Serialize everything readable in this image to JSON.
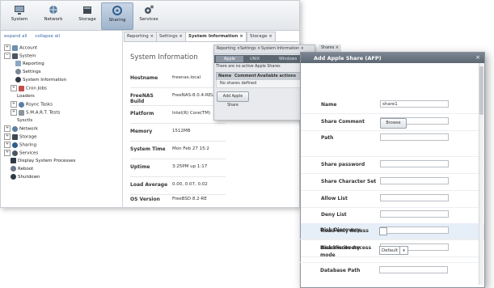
{
  "toolbar": {
    "items": [
      {
        "label": "System"
      },
      {
        "label": "Network"
      },
      {
        "label": "Storage"
      },
      {
        "label": "Sharing"
      },
      {
        "label": "Services"
      }
    ]
  },
  "sidebar": {
    "expand_all": "expand all",
    "collapse_all": "collapse all",
    "items": [
      {
        "label": "Account"
      },
      {
        "label": "System"
      },
      {
        "label": "Reporting"
      },
      {
        "label": "Settings"
      },
      {
        "label": "System Information"
      },
      {
        "label": "Cron Jobs"
      },
      {
        "label": "Loaders"
      },
      {
        "label": "Rsync Tasks"
      },
      {
        "label": "S.M.A.R.T. Tests"
      },
      {
        "label": "Sysctls"
      },
      {
        "label": "Network"
      },
      {
        "label": "Storage"
      },
      {
        "label": "Sharing"
      },
      {
        "label": "Services"
      },
      {
        "label": "Display System Processes"
      },
      {
        "label": "Reboot"
      },
      {
        "label": "Shutdown"
      }
    ]
  },
  "tabs": [
    {
      "label": "Reporting ×"
    },
    {
      "label": "Settings ×"
    },
    {
      "label": "System Information ×"
    },
    {
      "label": "Storage ×"
    }
  ],
  "sysinfo": {
    "title": "System Information",
    "rows": [
      {
        "k": "Hostname",
        "v": "freenas.local"
      },
      {
        "k": "FreeNAS Build",
        "v": "FreeNAS-8.0.4-RELEASE"
      },
      {
        "k": "Platform",
        "v": "Intel(R) Core(TM)"
      },
      {
        "k": "Memory",
        "v": "1512MB"
      },
      {
        "k": "System Time",
        "v": "Mon Feb 27 15:2"
      },
      {
        "k": "Uptime",
        "v": "3:25PM up 1:17"
      },
      {
        "k": "Load Average",
        "v": "0.00, 0.07, 0.02"
      },
      {
        "k": "OS Version",
        "v": "FreeBSD 8.2-RE"
      }
    ]
  },
  "middle": {
    "tabs": [
      {
        "label": "Reporting ×"
      },
      {
        "label": "Settings ×"
      },
      {
        "label": "System Information ×"
      },
      {
        "label": "Shares ×"
      }
    ],
    "subtabs": [
      {
        "label": "Apple"
      },
      {
        "label": "UNIX"
      },
      {
        "label": "Windows"
      }
    ],
    "notice": "There are no active Apple Shares",
    "columns": [
      "Name",
      "Comment",
      "Available actions"
    ],
    "empty": "No shares defined",
    "add_button": "Add Apple Share"
  },
  "modal": {
    "title": "Add Apple Share (AFP)",
    "close": "×",
    "fields": [
      {
        "label": "Name",
        "value": "share1"
      },
      {
        "label": "Share Comment",
        "value": ""
      },
      {
        "label": "Path",
        "value": ""
      },
      {
        "label": "Share password",
        "value": ""
      },
      {
        "label": "Share Character Set",
        "value": ""
      },
      {
        "label": "Allow List",
        "value": ""
      },
      {
        "label": "Deny List",
        "value": ""
      },
      {
        "label": "Read-only Access",
        "value": ""
      },
      {
        "label": "Read-write Access",
        "value": ""
      },
      {
        "label": "Disk Discovery",
        "value": ""
      },
      {
        "label": "Disk discovery mode",
        "value": ""
      },
      {
        "label": "Database Path",
        "value": ""
      }
    ],
    "browse_label": "Browse",
    "discovery_mode": "Default",
    "dropdown_glyph": "▾"
  },
  "colors": {
    "accent": "#3a6aa8",
    "header": "#5d6772",
    "highlight": "#e6eef8"
  }
}
